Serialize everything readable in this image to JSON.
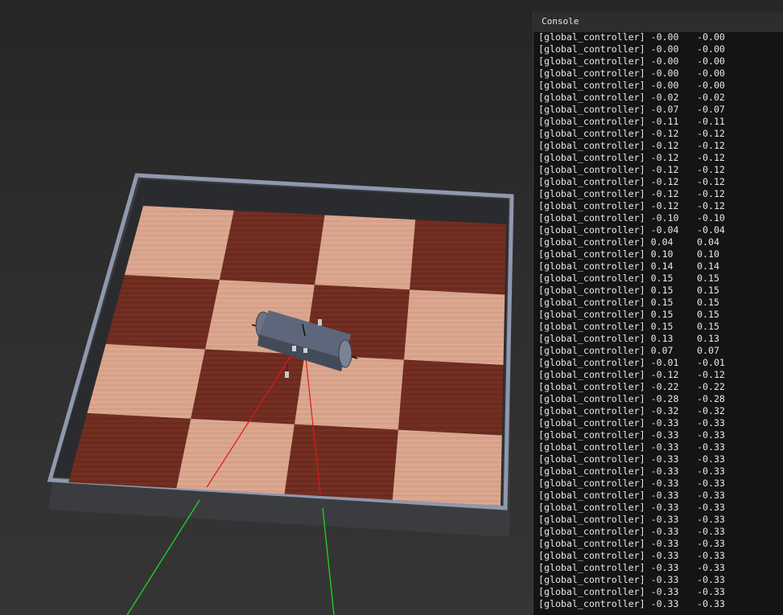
{
  "console": {
    "title": "Console",
    "lines": [
      {
        "tag": "[global_controller]",
        "v1": "-0.00",
        "v2": "-0.00"
      },
      {
        "tag": "[global_controller]",
        "v1": "-0.00",
        "v2": "-0.00"
      },
      {
        "tag": "[global_controller]",
        "v1": "-0.00",
        "v2": "-0.00"
      },
      {
        "tag": "[global_controller]",
        "v1": "-0.00",
        "v2": "-0.00"
      },
      {
        "tag": "[global_controller]",
        "v1": "-0.00",
        "v2": "-0.00"
      },
      {
        "tag": "[global_controller]",
        "v1": "-0.02",
        "v2": "-0.02"
      },
      {
        "tag": "[global_controller]",
        "v1": "-0.07",
        "v2": "-0.07"
      },
      {
        "tag": "[global_controller]",
        "v1": "-0.11",
        "v2": "-0.11"
      },
      {
        "tag": "[global_controller]",
        "v1": "-0.12",
        "v2": "-0.12"
      },
      {
        "tag": "[global_controller]",
        "v1": "-0.12",
        "v2": "-0.12"
      },
      {
        "tag": "[global_controller]",
        "v1": "-0.12",
        "v2": "-0.12"
      },
      {
        "tag": "[global_controller]",
        "v1": "-0.12",
        "v2": "-0.12"
      },
      {
        "tag": "[global_controller]",
        "v1": "-0.12",
        "v2": "-0.12"
      },
      {
        "tag": "[global_controller]",
        "v1": "-0.12",
        "v2": "-0.12"
      },
      {
        "tag": "[global_controller]",
        "v1": "-0.12",
        "v2": "-0.12"
      },
      {
        "tag": "[global_controller]",
        "v1": "-0.10",
        "v2": "-0.10"
      },
      {
        "tag": "[global_controller]",
        "v1": "-0.04",
        "v2": "-0.04"
      },
      {
        "tag": "[global_controller]",
        "v1": "0.04",
        "v2": "0.04"
      },
      {
        "tag": "[global_controller]",
        "v1": "0.10",
        "v2": "0.10"
      },
      {
        "tag": "[global_controller]",
        "v1": "0.14",
        "v2": "0.14"
      },
      {
        "tag": "[global_controller]",
        "v1": "0.15",
        "v2": "0.15"
      },
      {
        "tag": "[global_controller]",
        "v1": "0.15",
        "v2": "0.15"
      },
      {
        "tag": "[global_controller]",
        "v1": "0.15",
        "v2": "0.15"
      },
      {
        "tag": "[global_controller]",
        "v1": "0.15",
        "v2": "0.15"
      },
      {
        "tag": "[global_controller]",
        "v1": "0.15",
        "v2": "0.15"
      },
      {
        "tag": "[global_controller]",
        "v1": "0.13",
        "v2": "0.13"
      },
      {
        "tag": "[global_controller]",
        "v1": "0.07",
        "v2": "0.07"
      },
      {
        "tag": "[global_controller]",
        "v1": "-0.01",
        "v2": "-0.01"
      },
      {
        "tag": "[global_controller]",
        "v1": "-0.12",
        "v2": "-0.12"
      },
      {
        "tag": "[global_controller]",
        "v1": "-0.22",
        "v2": "-0.22"
      },
      {
        "tag": "[global_controller]",
        "v1": "-0.28",
        "v2": "-0.28"
      },
      {
        "tag": "[global_controller]",
        "v1": "-0.32",
        "v2": "-0.32"
      },
      {
        "tag": "[global_controller]",
        "v1": "-0.33",
        "v2": "-0.33"
      },
      {
        "tag": "[global_controller]",
        "v1": "-0.33",
        "v2": "-0.33"
      },
      {
        "tag": "[global_controller]",
        "v1": "-0.33",
        "v2": "-0.33"
      },
      {
        "tag": "[global_controller]",
        "v1": "-0.33",
        "v2": "-0.33"
      },
      {
        "tag": "[global_controller]",
        "v1": "-0.33",
        "v2": "-0.33"
      },
      {
        "tag": "[global_controller]",
        "v1": "-0.33",
        "v2": "-0.33"
      },
      {
        "tag": "[global_controller]",
        "v1": "-0.33",
        "v2": "-0.33"
      },
      {
        "tag": "[global_controller]",
        "v1": "-0.33",
        "v2": "-0.33"
      },
      {
        "tag": "[global_controller]",
        "v1": "-0.33",
        "v2": "-0.33"
      },
      {
        "tag": "[global_controller]",
        "v1": "-0.33",
        "v2": "-0.33"
      },
      {
        "tag": "[global_controller]",
        "v1": "-0.33",
        "v2": "-0.33"
      },
      {
        "tag": "[global_controller]",
        "v1": "-0.33",
        "v2": "-0.33"
      },
      {
        "tag": "[global_controller]",
        "v1": "-0.33",
        "v2": "-0.33"
      },
      {
        "tag": "[global_controller]",
        "v1": "-0.33",
        "v2": "-0.33"
      },
      {
        "tag": "[global_controller]",
        "v1": "-0.33",
        "v2": "-0.33"
      },
      {
        "tag": "[global_controller]",
        "v1": "-0.33",
        "v2": "-0.33"
      }
    ]
  },
  "scene": {
    "floor_light_color": "#d6a08a",
    "floor_dark_color": "#6e2b1f",
    "wall_color": "#8a93a8",
    "robot_color": "#5a6478",
    "sensor_ray_color": "#e01818",
    "guide_line_color": "#22cc22"
  }
}
